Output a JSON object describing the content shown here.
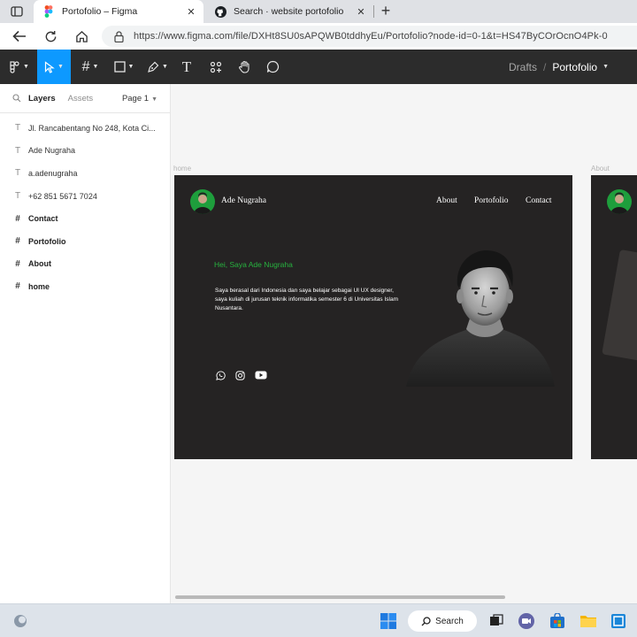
{
  "browser": {
    "tabs": [
      {
        "title": "Portofolio – Figma",
        "icon": "figma-icon",
        "active": true
      },
      {
        "title": "Search · website portofolio",
        "icon": "github-icon",
        "active": false
      }
    ],
    "new_tab_label": "+",
    "close_label": "✕",
    "url": "https://www.figma.com/file/DXHt8SU0sAPQWB0tddhyEu/Portofolio?node-id=0-1&t=HS47ByCOrOcnO4Pk-0"
  },
  "figma": {
    "toolbar": {
      "tools": [
        "main-menu",
        "move",
        "frame",
        "shape",
        "pen",
        "text",
        "resources",
        "hand",
        "comment"
      ],
      "text_tool_glyph": "T",
      "active_tool": "move"
    },
    "breadcrumb": {
      "folder": "Drafts",
      "separator": "/",
      "file": "Portofolio"
    },
    "layers_panel": {
      "tab_layers": "Layers",
      "tab_assets": "Assets",
      "page": "Page 1",
      "items": [
        {
          "type": "text",
          "label": "Jl. Rancabentang No 248, Kota Ci..."
        },
        {
          "type": "text",
          "label": "Ade Nugraha"
        },
        {
          "type": "text",
          "label": "a.adenugraha"
        },
        {
          "type": "text",
          "label": "+62 851 5671 7024"
        },
        {
          "type": "frame",
          "label": "Contact"
        },
        {
          "type": "frame",
          "label": "Portofolio"
        },
        {
          "type": "frame",
          "label": "About"
        },
        {
          "type": "frame",
          "label": "home"
        }
      ],
      "text_glyph": "T",
      "frame_glyph": "#"
    },
    "canvas": {
      "frame_labels": [
        "home",
        "About"
      ],
      "home": {
        "brand": "Ade Nugraha",
        "nav": [
          "About",
          "Portofolio",
          "Contact"
        ],
        "greeting": "Hei, Saya Ade Nugraha",
        "bio": "Saya berasal dari Indonesia dan saya belajar sebagai UI UX designer, saya kuliah di jurusan teknik informatika semester 6 di Universitas Islam Nusantara.",
        "social_icons": [
          "whatsapp-icon",
          "instagram-icon",
          "youtube-icon"
        ],
        "accent_color": "#27b33f",
        "background_color": "#252323"
      }
    }
  },
  "taskbar": {
    "search_label": "Search",
    "apps": [
      "start",
      "search",
      "task-view",
      "teams",
      "store",
      "file-explorer",
      "app"
    ]
  }
}
